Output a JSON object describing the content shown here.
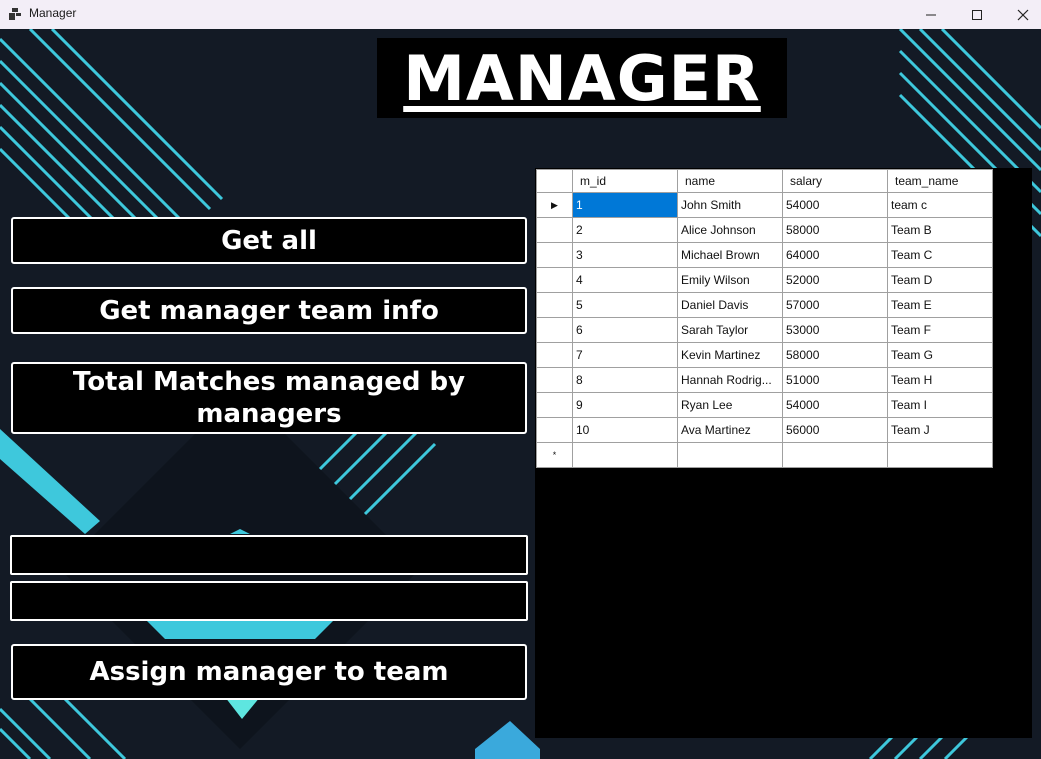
{
  "window": {
    "title": "Manager",
    "minimize_icon": "minimize-icon",
    "maximize_icon": "maximize-icon",
    "close_icon": "close-icon"
  },
  "header": {
    "title": "MANAGER"
  },
  "buttons": {
    "get_all": "Get all",
    "get_manager_team_info": "Get manager team info",
    "total_matches": "Total Matches managed by managers",
    "assign_manager": "Assign manager to team"
  },
  "inputs": {
    "input1": {
      "value": "",
      "placeholder": ""
    },
    "input2": {
      "value": "",
      "placeholder": ""
    }
  },
  "grid": {
    "columns": [
      "m_id",
      "name",
      "salary",
      "team_name"
    ],
    "rows": [
      [
        "1",
        "John Smith",
        "54000",
        "team c"
      ],
      [
        "2",
        "Alice Johnson",
        "58000",
        "Team B"
      ],
      [
        "3",
        "Michael Brown",
        "64000",
        "Team C"
      ],
      [
        "4",
        "Emily Wilson",
        "52000",
        "Team D"
      ],
      [
        "5",
        "Daniel Davis",
        "57000",
        "Team E"
      ],
      [
        "6",
        "Sarah Taylor",
        "53000",
        "Team F"
      ],
      [
        "7",
        "Kevin Martinez",
        "58000",
        "Team G"
      ],
      [
        "8",
        "Hannah Rodrig...",
        "51000",
        "Team H"
      ],
      [
        "9",
        "Ryan Lee",
        "54000",
        "Team I"
      ],
      [
        "10",
        "Ava Martinez",
        "56000",
        "Team J"
      ]
    ],
    "current_row_marker": "▶",
    "new_row_marker": "*"
  },
  "colors": {
    "background": "#131a25",
    "accent": "#3ec8dc",
    "selection": "#0078d7"
  }
}
